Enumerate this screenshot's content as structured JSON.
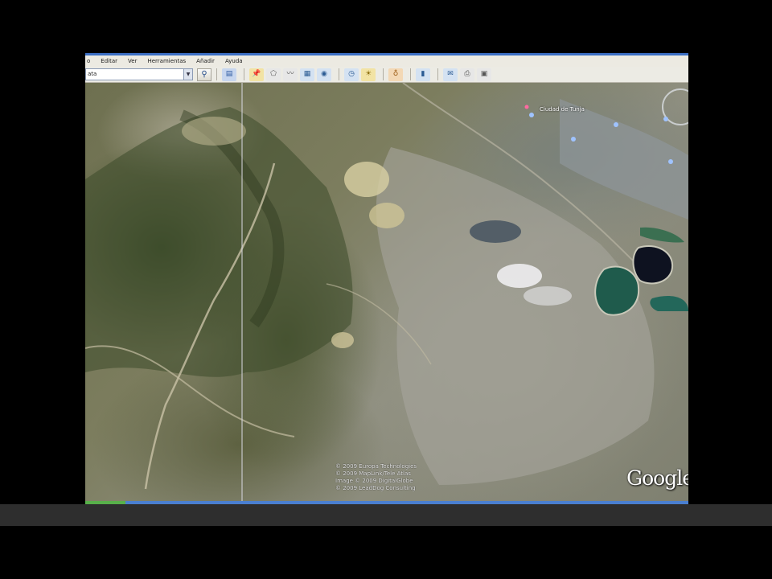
{
  "menu": {
    "items": [
      "o",
      "Editar",
      "Ver",
      "Herramientas",
      "Añadir",
      "Ayuda"
    ]
  },
  "toolbar": {
    "search_value": "ata",
    "search_dropdown_icon": "chevron-down-icon",
    "search_go_icon": "search-icon",
    "buttons": [
      "sidebar-toggle-icon",
      "placemark-icon",
      "polygon-icon",
      "path-icon",
      "image-overlay-icon",
      "record-tour-icon",
      "historical-imagery-icon",
      "sunlight-icon",
      "planets-icon",
      "ruler-icon",
      "email-icon",
      "print-icon",
      "view-in-maps-icon"
    ]
  },
  "map": {
    "place_label": "Ciudad de Tunja",
    "copyright": [
      "© 2009 Europa Technologies",
      "© 2009 MapLink/Tele Atlas",
      "Image © 2009 DigitalGlobe",
      "© 2009 LeadDog Consulting"
    ],
    "logo_text": "Google"
  },
  "status": {
    "progress": 0.066
  },
  "colors": {
    "window_title_blue": "#3c6fc4",
    "status_blue": "#4a7fd0",
    "status_green": "#58b04a",
    "toolbar_bg": "#ecebe4"
  }
}
